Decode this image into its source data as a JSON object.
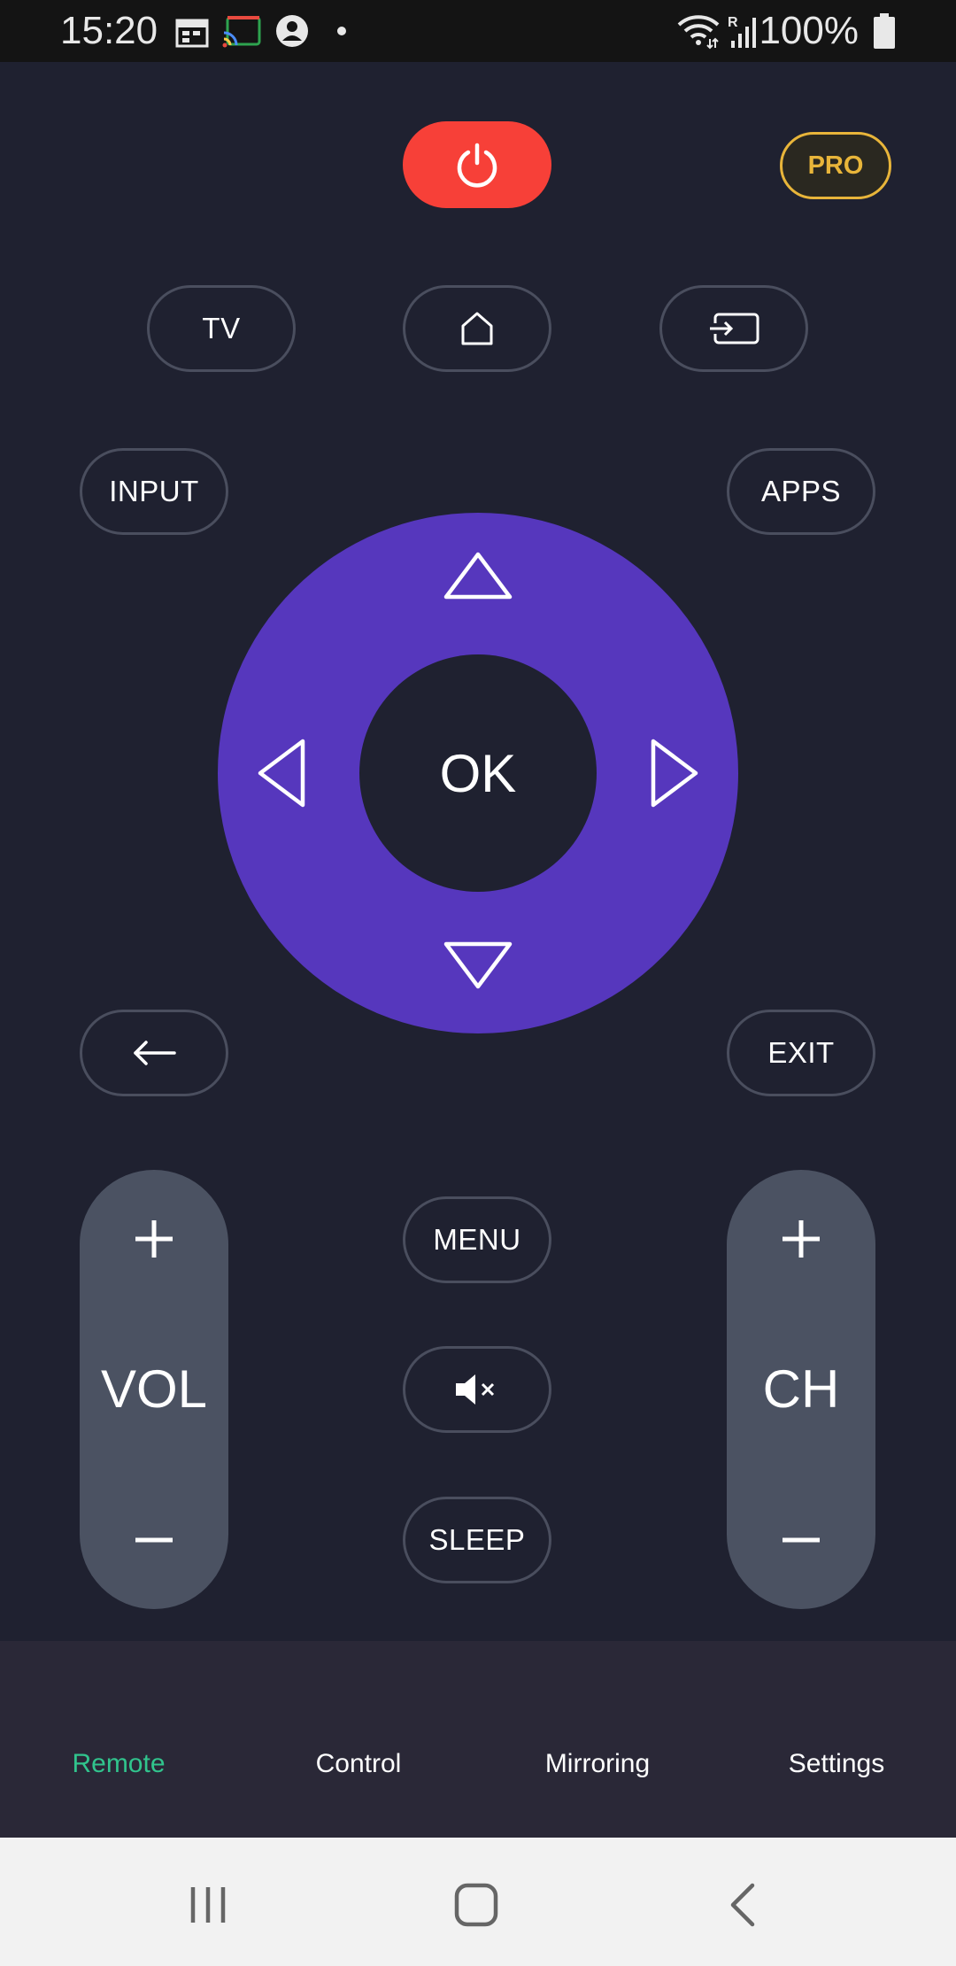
{
  "status_bar": {
    "time": "15:20",
    "battery": "100%",
    "icons": [
      "calendar-icon",
      "cast-icon",
      "account-icon",
      "dot-icon",
      "wifi-icon",
      "signal-icon",
      "battery-icon"
    ]
  },
  "remote": {
    "power_icon": "power-icon",
    "pro_label": "PRO",
    "tv_label": "TV",
    "home_icon": "home-icon",
    "source_icon": "source-icon",
    "input_label": "INPUT",
    "apps_label": "APPS",
    "ok_label": "OK",
    "back_icon": "back-arrow-icon",
    "exit_label": "EXIT",
    "vol_label": "VOL",
    "ch_label": "CH",
    "menu_label": "MENU",
    "mute_icon": "mute-icon",
    "sleep_label": "SLEEP"
  },
  "tabs": [
    {
      "label": "Remote",
      "active": true
    },
    {
      "label": "Control",
      "active": false
    },
    {
      "label": "Mirroring",
      "active": false
    },
    {
      "label": "Settings",
      "active": false
    }
  ],
  "colors": {
    "background": "#1f2130",
    "power": "#f74038",
    "pro": "#e8b53a",
    "dpad": "#5637bd",
    "rocker": "#4b5262",
    "active_tab": "#31c48d"
  }
}
